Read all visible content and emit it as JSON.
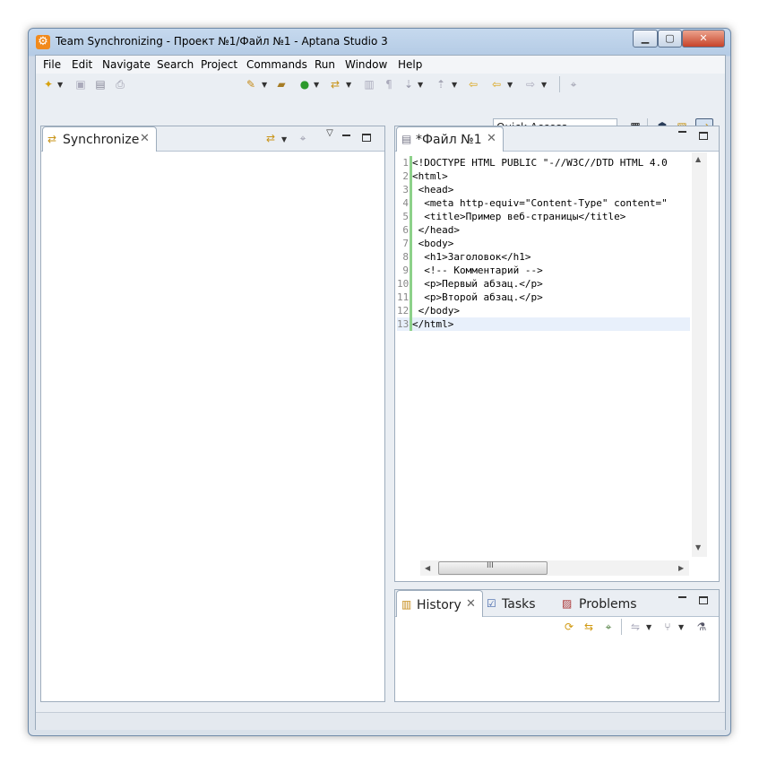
{
  "window": {
    "title": "Team Synchronizing - Проект №1/Файл №1 - Aptana Studio 3",
    "app_icon": "aptana-gear-icon",
    "controls": {
      "minimize": "minimize-icon",
      "maximize": "maximize-icon",
      "close": "close-icon"
    }
  },
  "menu": [
    "File",
    "Edit",
    "Navigate",
    "Search",
    "Project",
    "Commands",
    "Run",
    "Window",
    "Help"
  ],
  "toolbar": {
    "quick_access_placeholder": "Quick Access"
  },
  "synchronize_view": {
    "tab_label": "Synchronize",
    "close_glyph": "✕"
  },
  "editor": {
    "tab_label": "*Файл №1",
    "close_glyph": "✕",
    "lines": [
      {
        "n": "1",
        "text": "<!DOCTYPE HTML PUBLIC \"-//W3C//DTD HTML 4.0"
      },
      {
        "n": "2",
        "text": "<html>"
      },
      {
        "n": "3",
        "text": " <head>"
      },
      {
        "n": "4",
        "text": "  <meta http-equiv=\"Content-Type\" content=\""
      },
      {
        "n": "5",
        "text": "  <title>Пример веб-страницы</title>"
      },
      {
        "n": "6",
        "text": " </head>"
      },
      {
        "n": "7",
        "text": " <body>"
      },
      {
        "n": "8",
        "text": "  <h1>Заголовок</h1>"
      },
      {
        "n": "9",
        "text": "  <!-- Комментарий -->"
      },
      {
        "n": "10",
        "text": "  <p>Первый абзац.</p>"
      },
      {
        "n": "11",
        "text": "  <p>Второй абзац.</p>"
      },
      {
        "n": "12",
        "text": " </body>"
      },
      {
        "n": "13",
        "text": "</html>"
      }
    ],
    "hscroll_grip": "III"
  },
  "bottom_panel": {
    "tabs": [
      {
        "label": "History",
        "icon": "history-icon",
        "close": "✕"
      },
      {
        "label": "Tasks",
        "icon": "tasks-icon"
      },
      {
        "label": "Problems",
        "icon": "problems-icon"
      }
    ]
  }
}
